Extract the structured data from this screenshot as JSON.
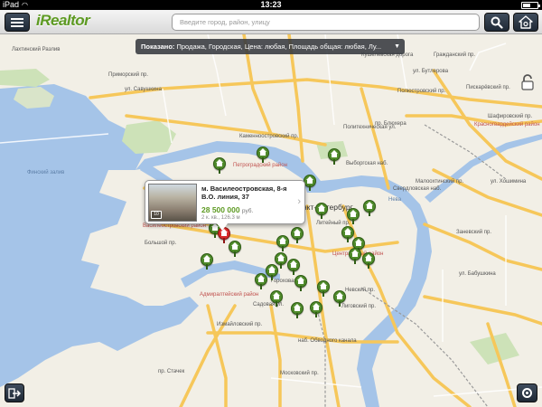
{
  "status_bar": {
    "carrier": "iPad",
    "time": "13:23",
    "battery_level": 0.55
  },
  "toolbar": {
    "logo": "iRealtor",
    "search_placeholder": "Введите город, район, улицу"
  },
  "filter": {
    "label": "Показано:",
    "value": "Продажа, Городская, Цена: любая, Площадь общая: любая, Лу..."
  },
  "map": {
    "labels": [
      "Петроградский район",
      "Санкт-Петербург",
      "Василеостровский район",
      "Центральный район",
      "Адмиралтейский район",
      "Приморский пр.",
      "ул. Савушкина",
      "Каменноостровский пр.",
      "Большой пр.",
      "Московский пр.",
      "Лиговский пр.",
      "наб. Обводного канала",
      "Невский пр.",
      "пр. Стачек",
      "Свердловская наб.",
      "Пискарёвский пр.",
      "Шафировский пр.",
      "ул. Бутлерова",
      "Гражданский пр.",
      "Кушелевская дорога",
      "ул. Хошимина",
      "Лахтинский Разлив",
      "Финский залив",
      "Нева",
      "Красногвардейский район",
      "Малоохтинский пр.",
      "ул. Бабушкина",
      "Заневский пр.",
      "Измайловский пр.",
      "Литейный пр.",
      "Выборгская наб.",
      "Садовая ул.",
      "Гороховая ул.",
      "Политехническая ул.",
      "пр. Блюхера",
      "Полюстровский пр."
    ]
  },
  "listing": {
    "address": "м. Василеостровская, 8-я В.О. линия, 37",
    "price": "28 500 000",
    "currency": "руб.",
    "details": "2 к. кв., 126.3 м",
    "photo_count": "10"
  }
}
